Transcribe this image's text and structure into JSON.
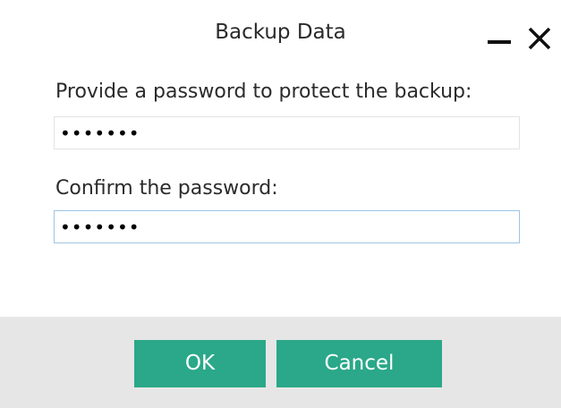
{
  "dialog": {
    "title": "Backup Data"
  },
  "form": {
    "password_label": "Provide a password to protect the backup:",
    "password_value": "•••••••",
    "confirm_label": "Confirm the password:",
    "confirm_value": "•••••••"
  },
  "buttons": {
    "ok_label": "OK",
    "cancel_label": "Cancel"
  },
  "colors": {
    "accent": "#2aa889",
    "footer_bg": "#e6e6e6",
    "focus_border": "#9ec4e3"
  },
  "icons": {
    "minimize": "minimize-icon",
    "close": "close-icon"
  }
}
